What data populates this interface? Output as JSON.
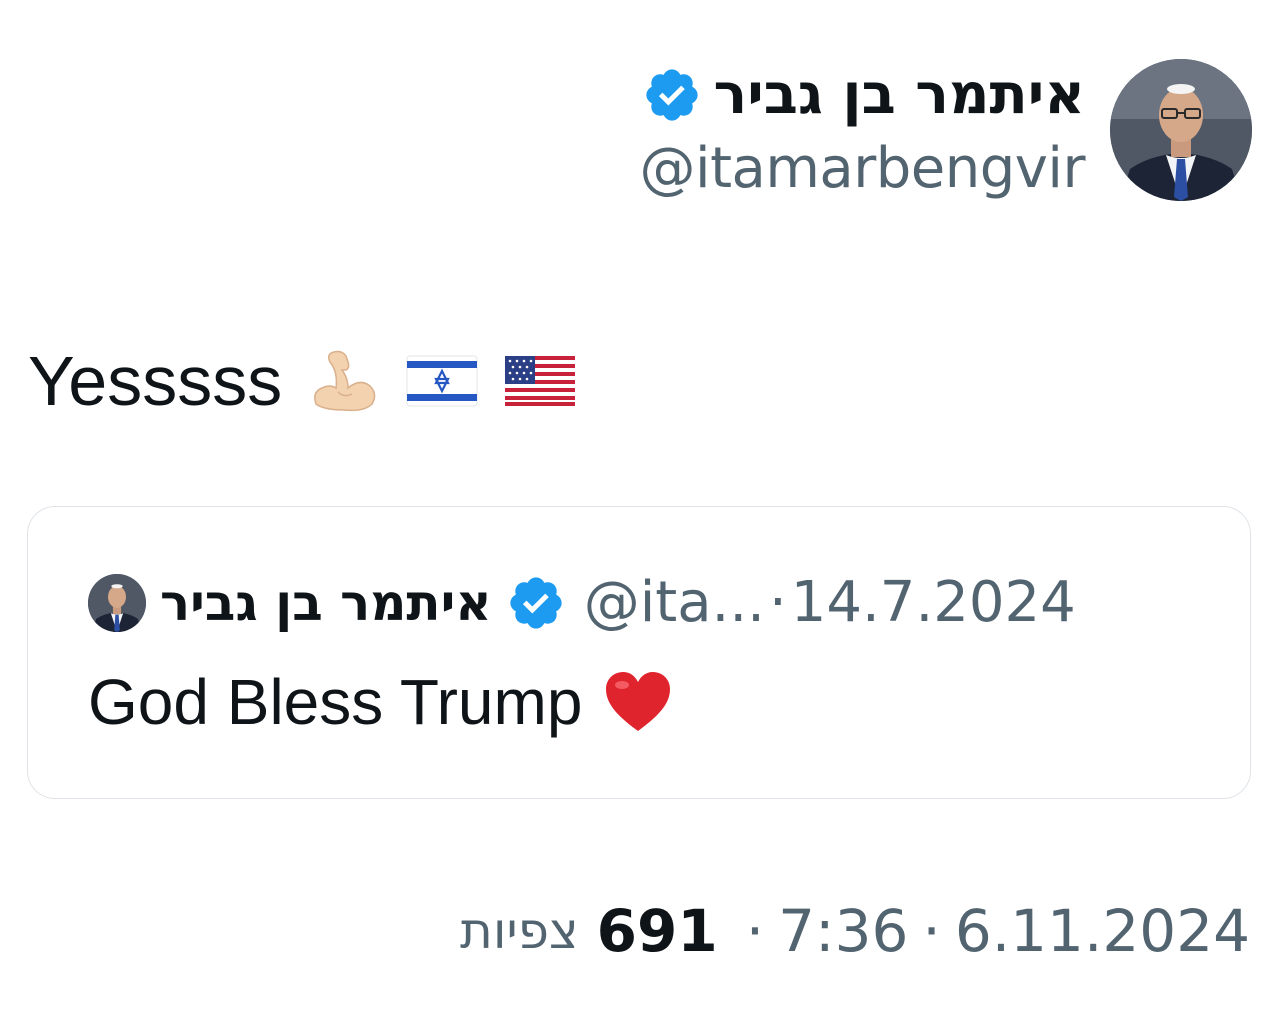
{
  "author": {
    "display_name": "איתמר בן גביר",
    "handle": "@itamarbengvir",
    "avatar_icon": "profile-photo",
    "verified_icon": "verified-badge-icon",
    "verified_color": "#1d9bf0"
  },
  "tweet": {
    "text": "Yesssss",
    "emojis": [
      "flexed-biceps-icon",
      "israel-flag-icon",
      "usa-flag-icon"
    ]
  },
  "quoted_tweet": {
    "display_name": "איתמר בן גביר",
    "handle": "@ita...",
    "separator": "·",
    "date": "14.7.2024",
    "text": "God Bless Trump",
    "emoji": "red-heart-icon"
  },
  "meta": {
    "views_label": "צפיות",
    "views_count": "691",
    "separator": "·",
    "time": "7:36",
    "date": "6.11.2024"
  },
  "colors": {
    "text_primary": "#0f1419",
    "text_secondary": "#536471",
    "border": "#dfe3e7",
    "verified": "#1d9bf0",
    "heart": "#e0242e"
  }
}
